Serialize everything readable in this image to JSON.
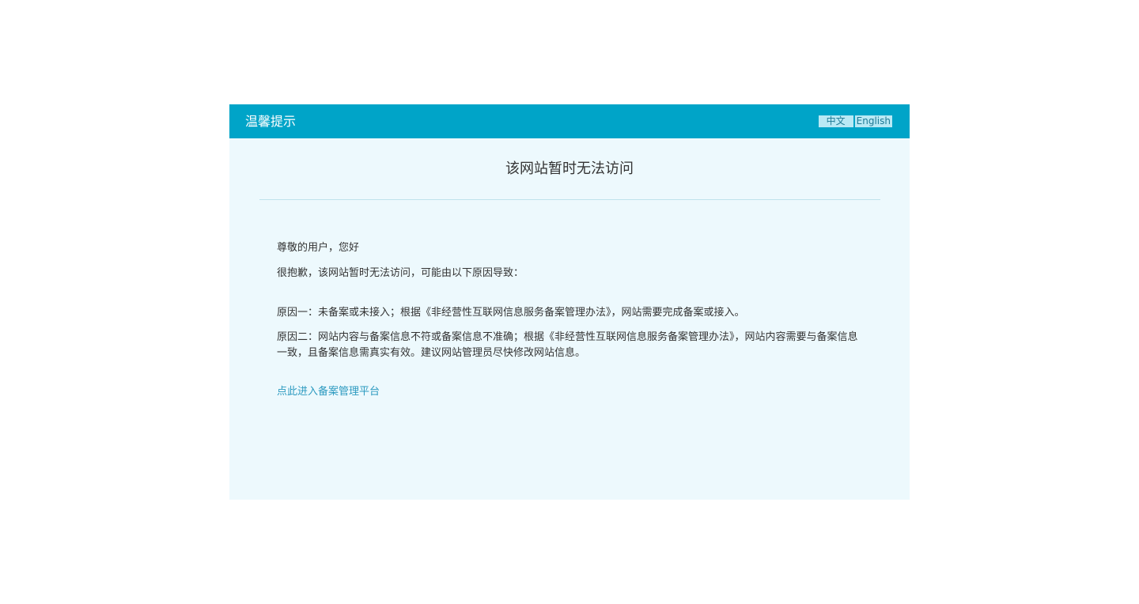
{
  "header": {
    "title": "温馨提示",
    "lang_zh": "中文",
    "lang_en": "English"
  },
  "main": {
    "title": "该网站暂时无法访问",
    "greeting": "尊敬的用户，您好",
    "intro": "很抱歉，该网站暂时无法访问，可能由以下原因导致：",
    "reason1": "原因一：未备案或未接入；根据《非经营性互联网信息服务备案管理办法》，网站需要完成备案或接入。",
    "reason2": "原因二：网站内容与备案信息不符或备案信息不准确；根据《非经营性互联网信息服务备案管理办法》，网站内容需要与备案信息一致，且备案信息需真实有效。建议网站管理员尽快修改网站信息。",
    "link_text": "点此进入备案管理平台"
  },
  "colors": {
    "header_bg": "#00a4c8",
    "panel_bg": "#edf9fd",
    "link": "#2c9ac0"
  }
}
